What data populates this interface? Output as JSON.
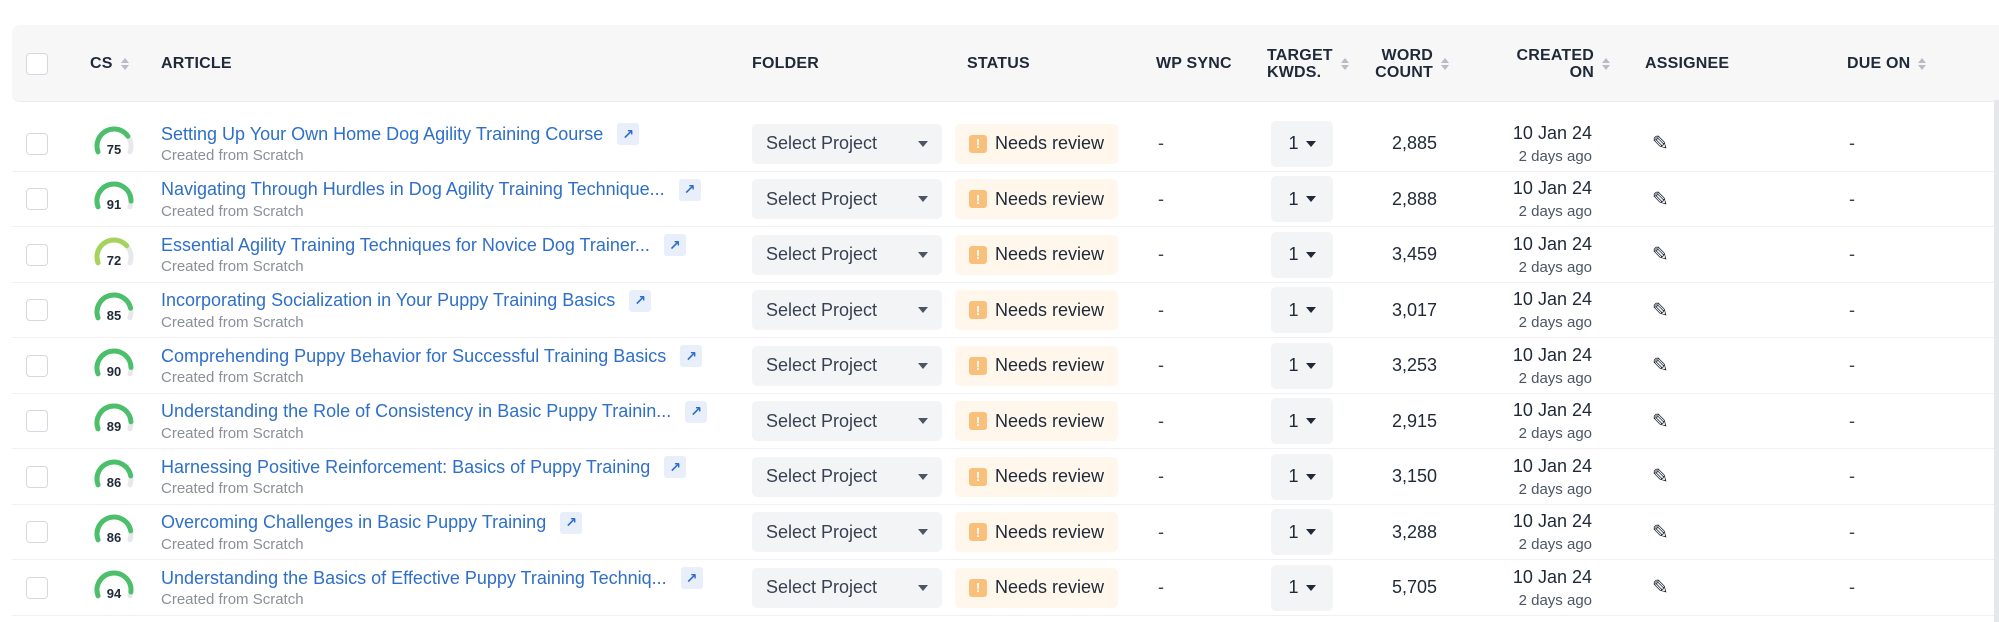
{
  "columns": {
    "cs": "CS",
    "article": "ARTICLE",
    "folder": "FOLDER",
    "status": "STATUS",
    "wp_sync": "WP SYNC",
    "target_kwds_line1": "TARGET",
    "target_kwds_line2": "KWDS.",
    "word_count_line1": "WORD",
    "word_count_line2": "COUNT",
    "created_on_line1": "CREATED",
    "created_on_line2": "ON",
    "assignee": "ASSIGNEE",
    "due_on": "DUE ON"
  },
  "colors": {
    "gauge_green": "#4cbf6a",
    "gauge_lime": "#a6d35c",
    "gauge_track": "#e6e8ec",
    "link_blue": "#2e6fc9"
  },
  "rows": [
    {
      "score": 75,
      "title": "Setting Up Your Own Home Dog Agility Training Course",
      "subtitle": "Created from Scratch",
      "folder": "Select Project",
      "status": "Needs review",
      "wp_sync": "-",
      "keywords": "1",
      "word_count": "2,885",
      "date": "10 Jan 24",
      "ago": "2 days ago",
      "due": "-"
    },
    {
      "score": 91,
      "title": "Navigating Through Hurdles in Dog Agility Training Technique...",
      "subtitle": "Created from Scratch",
      "folder": "Select Project",
      "status": "Needs review",
      "wp_sync": "-",
      "keywords": "1",
      "word_count": "2,888",
      "date": "10 Jan 24",
      "ago": "2 days ago",
      "due": "-"
    },
    {
      "score": 72,
      "title": "Essential Agility Training Techniques for Novice Dog Trainer...",
      "subtitle": "Created from Scratch",
      "folder": "Select Project",
      "status": "Needs review",
      "wp_sync": "-",
      "keywords": "1",
      "word_count": "3,459",
      "date": "10 Jan 24",
      "ago": "2 days ago",
      "due": "-"
    },
    {
      "score": 85,
      "title": "Incorporating Socialization in Your Puppy Training Basics",
      "subtitle": "Created from Scratch",
      "folder": "Select Project",
      "status": "Needs review",
      "wp_sync": "-",
      "keywords": "1",
      "word_count": "3,017",
      "date": "10 Jan 24",
      "ago": "2 days ago",
      "due": "-"
    },
    {
      "score": 90,
      "title": "Comprehending Puppy Behavior for Successful Training Basics",
      "subtitle": "Created from Scratch",
      "folder": "Select Project",
      "status": "Needs review",
      "wp_sync": "-",
      "keywords": "1",
      "word_count": "3,253",
      "date": "10 Jan 24",
      "ago": "2 days ago",
      "due": "-"
    },
    {
      "score": 89,
      "title": "Understanding the Role of Consistency in Basic Puppy Trainin...",
      "subtitle": "Created from Scratch",
      "folder": "Select Project",
      "status": "Needs review",
      "wp_sync": "-",
      "keywords": "1",
      "word_count": "2,915",
      "date": "10 Jan 24",
      "ago": "2 days ago",
      "due": "-"
    },
    {
      "score": 86,
      "title": "Harnessing Positive Reinforcement: Basics of Puppy Training",
      "subtitle": "Created from Scratch",
      "folder": "Select Project",
      "status": "Needs review",
      "wp_sync": "-",
      "keywords": "1",
      "word_count": "3,150",
      "date": "10 Jan 24",
      "ago": "2 days ago",
      "due": "-"
    },
    {
      "score": 86,
      "title": "Overcoming Challenges in Basic Puppy Training",
      "subtitle": "Created from Scratch",
      "folder": "Select Project",
      "status": "Needs review",
      "wp_sync": "-",
      "keywords": "1",
      "word_count": "3,288",
      "date": "10 Jan 24",
      "ago": "2 days ago",
      "due": "-"
    },
    {
      "score": 94,
      "title": "Understanding the Basics of Effective Puppy Training Techniq...",
      "subtitle": "Created from Scratch",
      "folder": "Select Project",
      "status": "Needs review",
      "wp_sync": "-",
      "keywords": "1",
      "word_count": "5,705",
      "date": "10 Jan 24",
      "ago": "2 days ago",
      "due": "-"
    }
  ]
}
